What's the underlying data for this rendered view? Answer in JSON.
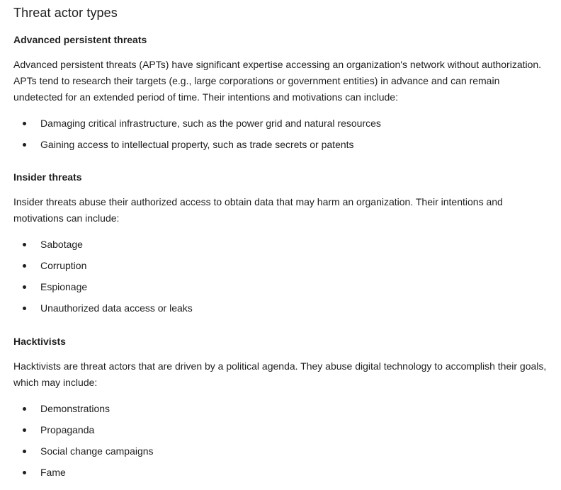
{
  "title": "Threat actor types",
  "sections": [
    {
      "heading": "Advanced persistent threats",
      "paragraph": "Advanced persistent threats (APTs) have significant expertise accessing an organization's network without authorization. APTs tend to research their targets (e.g., large corporations or government entities)  in advance and can remain undetected for an extended period of time. Their intentions and motivations can include:",
      "items": [
        "Damaging critical infrastructure, such as the power grid and natural resources",
        "Gaining access to intellectual property, such as trade secrets or patents"
      ]
    },
    {
      "heading": "Insider threats",
      "paragraph": "Insider threats abuse their authorized access to obtain data that may harm an organization. Their intentions and motivations can include:",
      "items": [
        "Sabotage",
        "Corruption",
        "Espionage",
        "Unauthorized data access or leaks"
      ]
    },
    {
      "heading": "Hacktivists",
      "paragraph": "Hacktivists are threat actors that are driven by a political agenda. They abuse digital technology to accomplish their goals, which may include:",
      "items": [
        "Demonstrations",
        "Propaganda",
        "Social change campaigns",
        "Fame"
      ]
    }
  ]
}
